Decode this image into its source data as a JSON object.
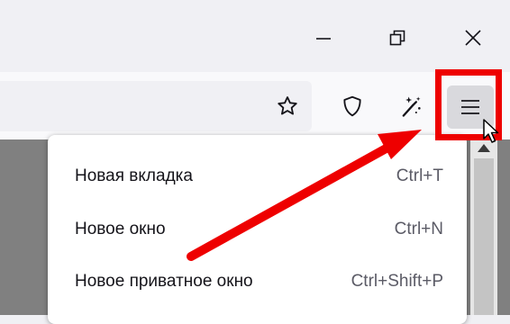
{
  "window_controls": {
    "minimize_icon": "minimize-icon",
    "restore_icon": "restore-icon",
    "close_icon": "close-icon"
  },
  "toolbar": {
    "icons": [
      "star-bookmark-icon",
      "shield-icon",
      "magic-sparkle-icon",
      "hamburger-menu-icon"
    ]
  },
  "menu": {
    "items": [
      {
        "label": "Новая вкладка",
        "shortcut": "Ctrl+T"
      },
      {
        "label": "Новое окно",
        "shortcut": "Ctrl+N"
      },
      {
        "label": "Новое приватное окно",
        "shortcut": "Ctrl+Shift+P"
      }
    ]
  },
  "colors": {
    "annotation": "#ee0000",
    "menu_button_bg": "#d9d9dd",
    "page_bg": "#808080"
  }
}
